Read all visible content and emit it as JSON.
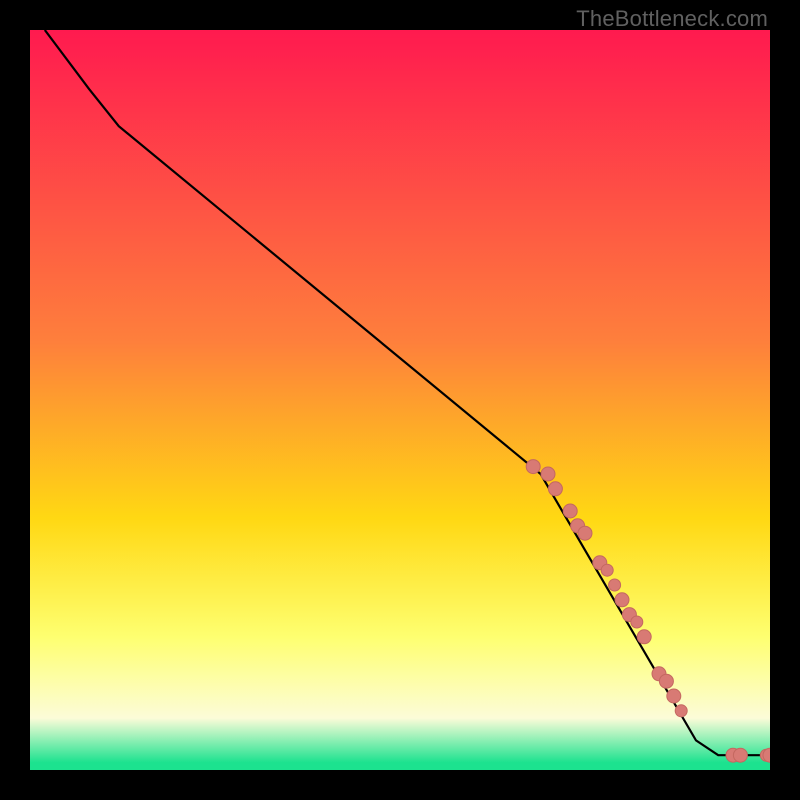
{
  "watermark": "TheBottleneck.com",
  "colors": {
    "frame": "#000000",
    "line": "#000000",
    "marker_fill": "#D87A74",
    "marker_stroke": "#C46860",
    "grad_top": "#FF1A4F",
    "grad_mid1": "#FE7F3C",
    "grad_mid2": "#FFD813",
    "grad_mid3": "#FEFF70",
    "grad_mid4": "#FCFCD8",
    "grad_low": "#1CE28F"
  },
  "chart_data": {
    "type": "line",
    "title": "",
    "xlabel": "",
    "ylabel": "",
    "xlim": [
      0,
      100
    ],
    "ylim": [
      0,
      100
    ],
    "line_points": [
      {
        "x": 2,
        "y": 100
      },
      {
        "x": 8,
        "y": 92
      },
      {
        "x": 12,
        "y": 87
      },
      {
        "x": 69,
        "y": 40
      },
      {
        "x": 90,
        "y": 4
      },
      {
        "x": 93,
        "y": 2
      },
      {
        "x": 100,
        "y": 2
      }
    ],
    "marker_points": [
      {
        "x": 68,
        "y": 41,
        "r": 7
      },
      {
        "x": 70,
        "y": 40,
        "r": 7
      },
      {
        "x": 71,
        "y": 38,
        "r": 7
      },
      {
        "x": 73,
        "y": 35,
        "r": 7
      },
      {
        "x": 74,
        "y": 33,
        "r": 7
      },
      {
        "x": 75,
        "y": 32,
        "r": 7
      },
      {
        "x": 77,
        "y": 28,
        "r": 7
      },
      {
        "x": 78,
        "y": 27,
        "r": 6
      },
      {
        "x": 79,
        "y": 25,
        "r": 6
      },
      {
        "x": 80,
        "y": 23,
        "r": 7
      },
      {
        "x": 81,
        "y": 21,
        "r": 7
      },
      {
        "x": 82,
        "y": 20,
        "r": 6
      },
      {
        "x": 83,
        "y": 18,
        "r": 7
      },
      {
        "x": 85,
        "y": 13,
        "r": 7
      },
      {
        "x": 86,
        "y": 12,
        "r": 7
      },
      {
        "x": 87,
        "y": 10,
        "r": 7
      },
      {
        "x": 88,
        "y": 8,
        "r": 6
      },
      {
        "x": 95,
        "y": 2,
        "r": 7
      },
      {
        "x": 96,
        "y": 2,
        "r": 7
      },
      {
        "x": 99.5,
        "y": 2,
        "r": 6
      },
      {
        "x": 100,
        "y": 2,
        "r": 7
      }
    ]
  }
}
